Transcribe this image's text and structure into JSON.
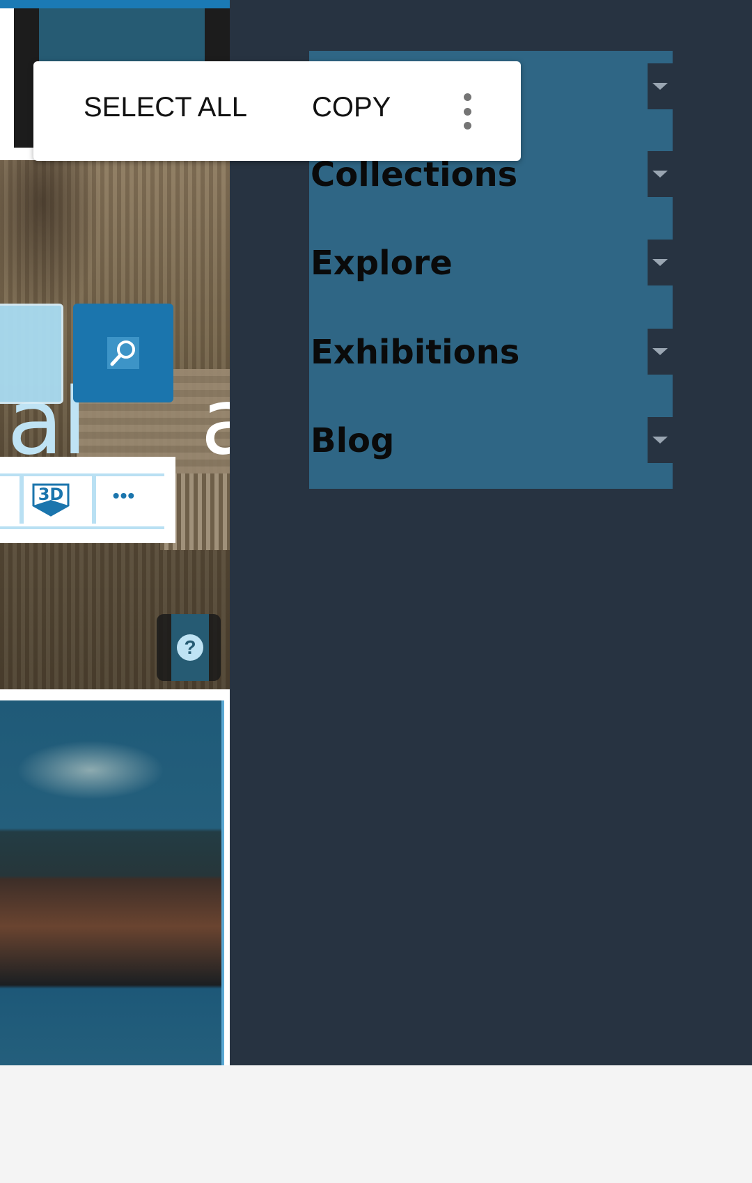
{
  "context_menu": {
    "select_all": "SELECT ALL",
    "copy": "COPY",
    "more_icon": "overflow-menu-icon"
  },
  "nav_menu": {
    "items": [
      {
        "label": "",
        "toggle_icon": "caret-down-icon"
      },
      {
        "label": "Collections",
        "toggle_icon": "caret-down-icon"
      },
      {
        "label": "Explore",
        "toggle_icon": "caret-down-icon"
      },
      {
        "label": "Exhibitions",
        "toggle_icon": "caret-down-icon"
      },
      {
        "label": "Blog",
        "toggle_icon": "caret-down-icon"
      }
    ]
  },
  "page_preview": {
    "hero_text": "al",
    "hero_text_cont": "a",
    "tool_3d_label": "3D",
    "tool_more_label": "•••",
    "help_label": "?"
  },
  "colors": {
    "nav_background": "#2f6685",
    "page_background": "#273341",
    "accent_blue": "#1b75ad",
    "light_blue": "#bfe3f4"
  }
}
